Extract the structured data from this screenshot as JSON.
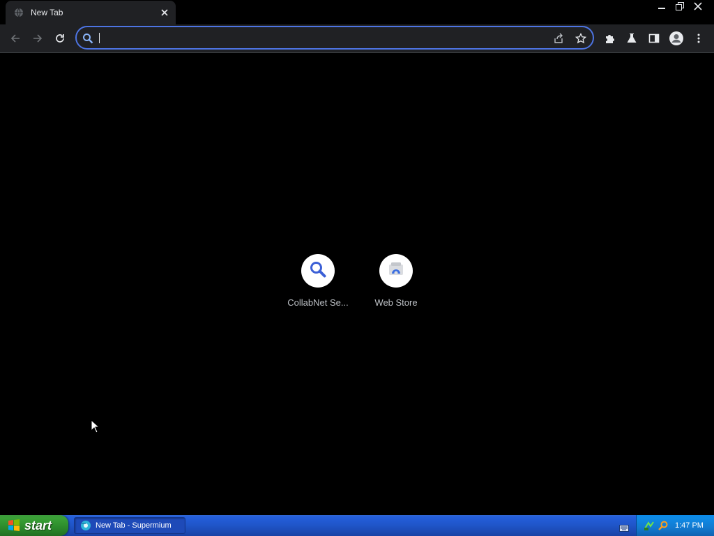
{
  "browser": {
    "tab": {
      "title": "New Tab"
    },
    "omnibox": {
      "value": "",
      "placeholder": ""
    }
  },
  "shortcuts": [
    {
      "label": "CollabNet Se...",
      "icon": "search-icon"
    },
    {
      "label": "Web Store",
      "icon": "web-store-icon"
    }
  ],
  "taskbar": {
    "start_label": "start",
    "task_item_label": "New Tab - Supermium",
    "clock": "1:47 PM"
  },
  "colors": {
    "page_background": "#000000",
    "toolbar": "#202124",
    "omnibox_focus_ring": "#4d74e3",
    "taskbar_blue": "#245edb",
    "start_green": "#3aa136"
  }
}
